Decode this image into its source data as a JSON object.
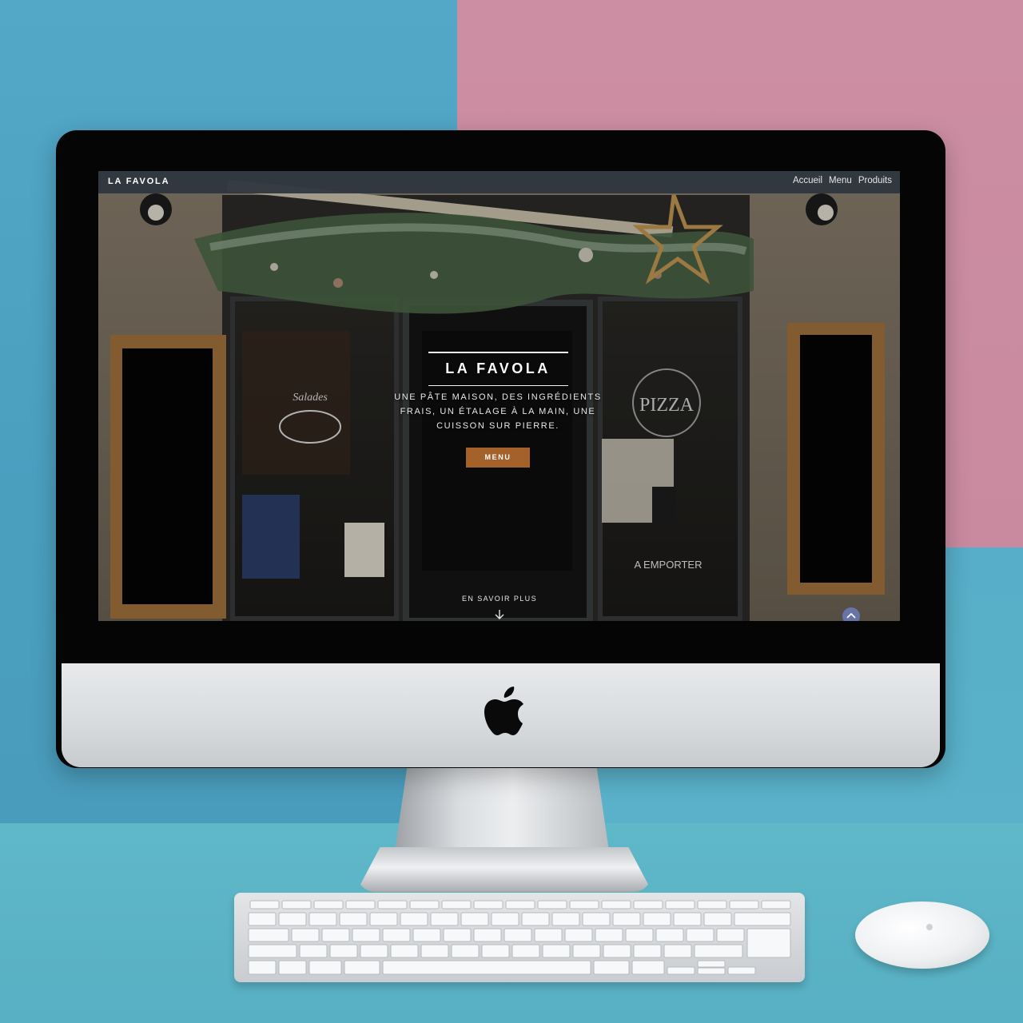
{
  "site": {
    "brand": "LA FAVOLA",
    "nav": [
      {
        "label": "Accueil"
      },
      {
        "label": "Menu"
      },
      {
        "label": "Produits"
      }
    ]
  },
  "hero": {
    "title": "LA FAVOLA",
    "tagline": "UNE PÂTE MAISON, DES INGRÉDIENTS FRAIS, UN ÉTALAGE À LA MAIN, UNE CUISSON SUR PIERRE.",
    "cta_label": "MENU",
    "learn_more": "EN SAVOIR PLUS"
  },
  "storefront_signs": {
    "salades": "Salades",
    "pizza": "PIZZA",
    "a_emporter": "A EMPORTER"
  },
  "colors": {
    "cta": "#a5612a",
    "navbar": "#2d343e",
    "wall_blue": "#4a9fbf",
    "wall_pink": "#c98a9f"
  },
  "icons": [
    "apple-logo-icon",
    "arrow-down-icon",
    "chevron-up-icon"
  ]
}
